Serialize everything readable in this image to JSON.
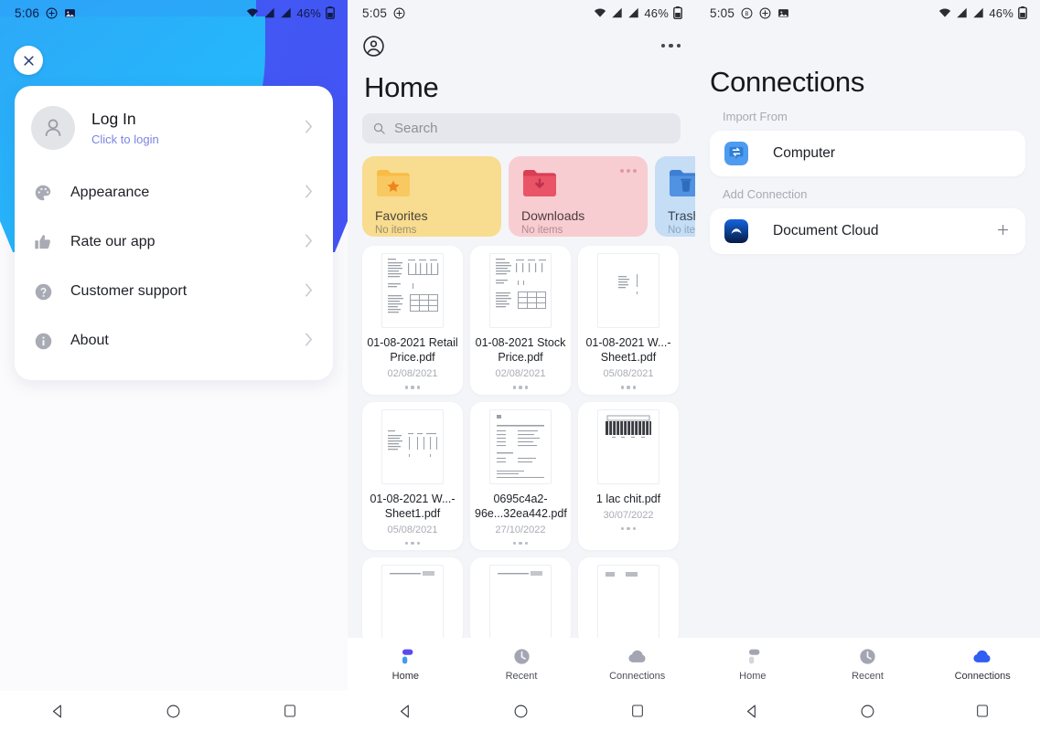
{
  "panels": {
    "left": {
      "statusbar": {
        "time": "5:06",
        "battery": "46%",
        "icons": [
          "plus-circle-icon",
          "image-icon",
          "wifi-icon",
          "signal-icon",
          "signal-icon",
          "battery-icon"
        ]
      },
      "close_label": "close-icon",
      "login": {
        "title": "Log In",
        "subtitle": "Click to login",
        "avatar": "person-avatar-icon",
        "chevron": "chevron-right-icon"
      },
      "menu": [
        {
          "label": "Appearance",
          "icon": "palette-icon"
        },
        {
          "label": "Rate our app",
          "icon": "thumbs-up-icon"
        },
        {
          "label": "Customer support",
          "icon": "question-circle-icon"
        },
        {
          "label": "About",
          "icon": "info-circle-icon"
        }
      ]
    },
    "middle": {
      "statusbar": {
        "time": "5:05",
        "battery": "46%"
      },
      "account_icon": "account-circle-icon",
      "overflow_icon": "more-horizontal-icon",
      "title": "Home",
      "search": {
        "placeholder": "Search",
        "icon": "search-icon"
      },
      "folders": [
        {
          "name": "Favorites",
          "subtitle": "No items",
          "icon": "folder-star-icon",
          "bg": "#f8dc8f",
          "fg": "#4a4438",
          "sub_fg": "#9a8f6e",
          "folder_color": "#f4b93e",
          "has_dots": false
        },
        {
          "name": "Downloads",
          "subtitle": "No items",
          "icon": "folder-download-icon",
          "bg": "#f8cdd1",
          "fg": "#4a3b3d",
          "sub_fg": "#b08b90",
          "folder_color": "#e8546a",
          "has_dots": true
        },
        {
          "name": "Trash",
          "subtitle": "No items",
          "icon": "folder-trash-icon",
          "bg": "#c5ddf5",
          "fg": "#3a4452",
          "sub_fg": "#8fa5bd",
          "folder_color": "#4a8ee0",
          "has_dots": false
        }
      ],
      "files": [
        {
          "name": "01-08-2021 Retail Price.pdf",
          "date": "02/08/2021",
          "thumb": "spreadsheet"
        },
        {
          "name": "01-08-2021 Stock Price.pdf",
          "date": "02/08/2021",
          "thumb": "spreadsheet"
        },
        {
          "name": "01-08-2021 W...-Sheet1.pdf",
          "date": "05/08/2021",
          "thumb": "sparse"
        },
        {
          "name": "01-08-2021 W...-Sheet1.pdf",
          "date": "05/08/2021",
          "thumb": "table"
        },
        {
          "name": "0695c4a2-96e...32ea442.pdf",
          "date": "27/10/2022",
          "thumb": "invoice"
        },
        {
          "name": "1 lac chit.pdf",
          "date": "30/07/2022",
          "thumb": "barcode"
        }
      ],
      "nav": [
        {
          "label": "Home",
          "icon": "home-icon",
          "active": true
        },
        {
          "label": "Recent",
          "icon": "clock-icon",
          "active": false
        },
        {
          "label": "Connections",
          "icon": "cloud-icon",
          "active": false
        }
      ]
    },
    "right": {
      "statusbar": {
        "time": "5:05",
        "battery": "46%",
        "icons": [
          "b-circle-icon",
          "plus-circle-icon",
          "image-icon"
        ]
      },
      "title": "Connections",
      "sections": [
        {
          "label": "Import From",
          "items": [
            {
              "name": "Computer",
              "icon": "computer-transfer-icon",
              "action": null
            }
          ]
        },
        {
          "label": "Add Connection",
          "items": [
            {
              "name": "Document Cloud",
              "icon": "document-cloud-icon",
              "action": "plus-icon"
            }
          ]
        }
      ],
      "nav": [
        {
          "label": "Home",
          "icon": "home-icon",
          "active": false
        },
        {
          "label": "Recent",
          "icon": "clock-icon",
          "active": false
        },
        {
          "label": "Connections",
          "icon": "cloud-icon",
          "active": true
        }
      ]
    }
  },
  "system_nav": {
    "back": "back-triangle-icon",
    "home": "home-circle-icon",
    "recents": "recents-square-icon"
  },
  "colors": {
    "accent_blue": "#4a5ef5",
    "cyan": "#25b0fa",
    "nav_active": "#3f4ff0",
    "nav_inactive": "#a0a3ae"
  }
}
